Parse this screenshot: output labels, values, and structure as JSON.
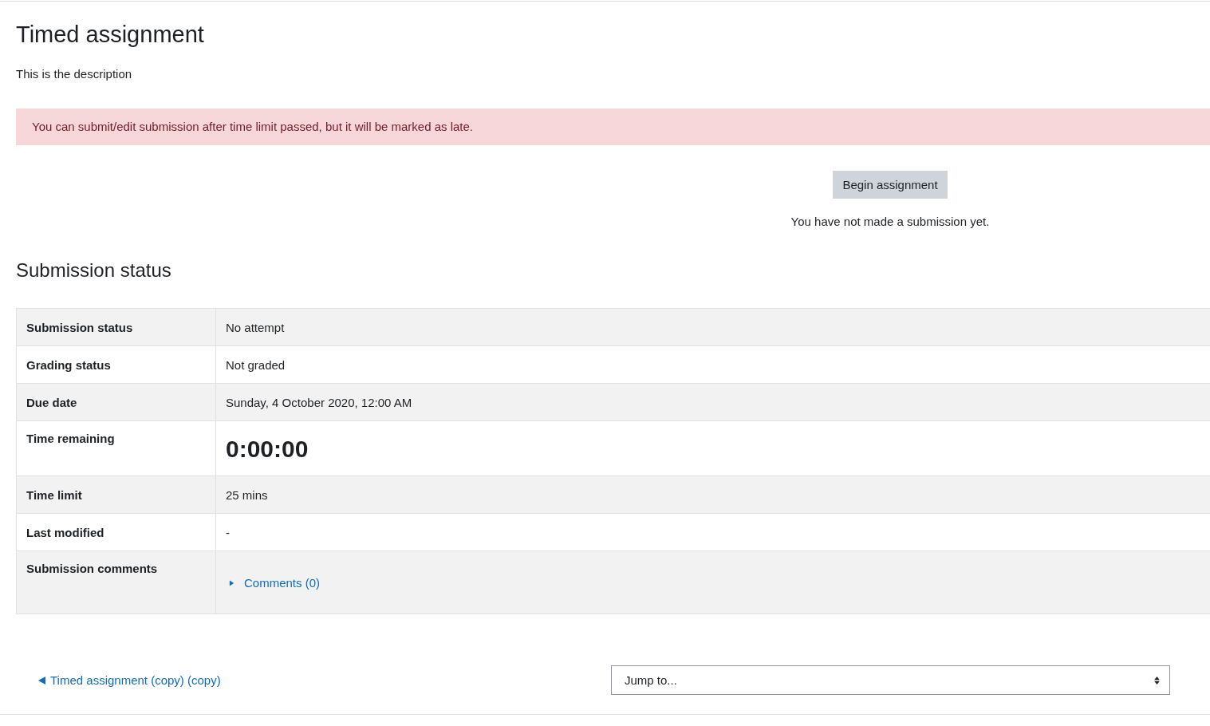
{
  "page": {
    "title": "Timed assignment",
    "description": "This is the description"
  },
  "alert": {
    "text": "You can submit/edit submission after time limit passed, but it will be marked as late."
  },
  "action": {
    "button": "Begin assignment",
    "note": "You have not made a submission yet."
  },
  "submission_status": {
    "heading": "Submission status",
    "rows": [
      {
        "kind": "text",
        "label": "Submission status",
        "value": "No attempt"
      },
      {
        "kind": "text",
        "label": "Grading status",
        "value": "Not graded"
      },
      {
        "kind": "text",
        "label": "Due date",
        "value": "Sunday, 4 October 2020, 12:00 AM"
      },
      {
        "kind": "timer",
        "label": "Time remaining",
        "value": "0:00:00"
      },
      {
        "kind": "text",
        "label": "Time limit",
        "value": "25 mins"
      },
      {
        "kind": "text",
        "label": "Last modified",
        "value": "-"
      },
      {
        "kind": "comments",
        "label": "Submission comments",
        "value": "Comments (0)",
        "expanded": false
      }
    ]
  },
  "footer": {
    "previous_link": "Timed assignment (copy) (copy)",
    "jump_select": "Jump to..."
  }
}
